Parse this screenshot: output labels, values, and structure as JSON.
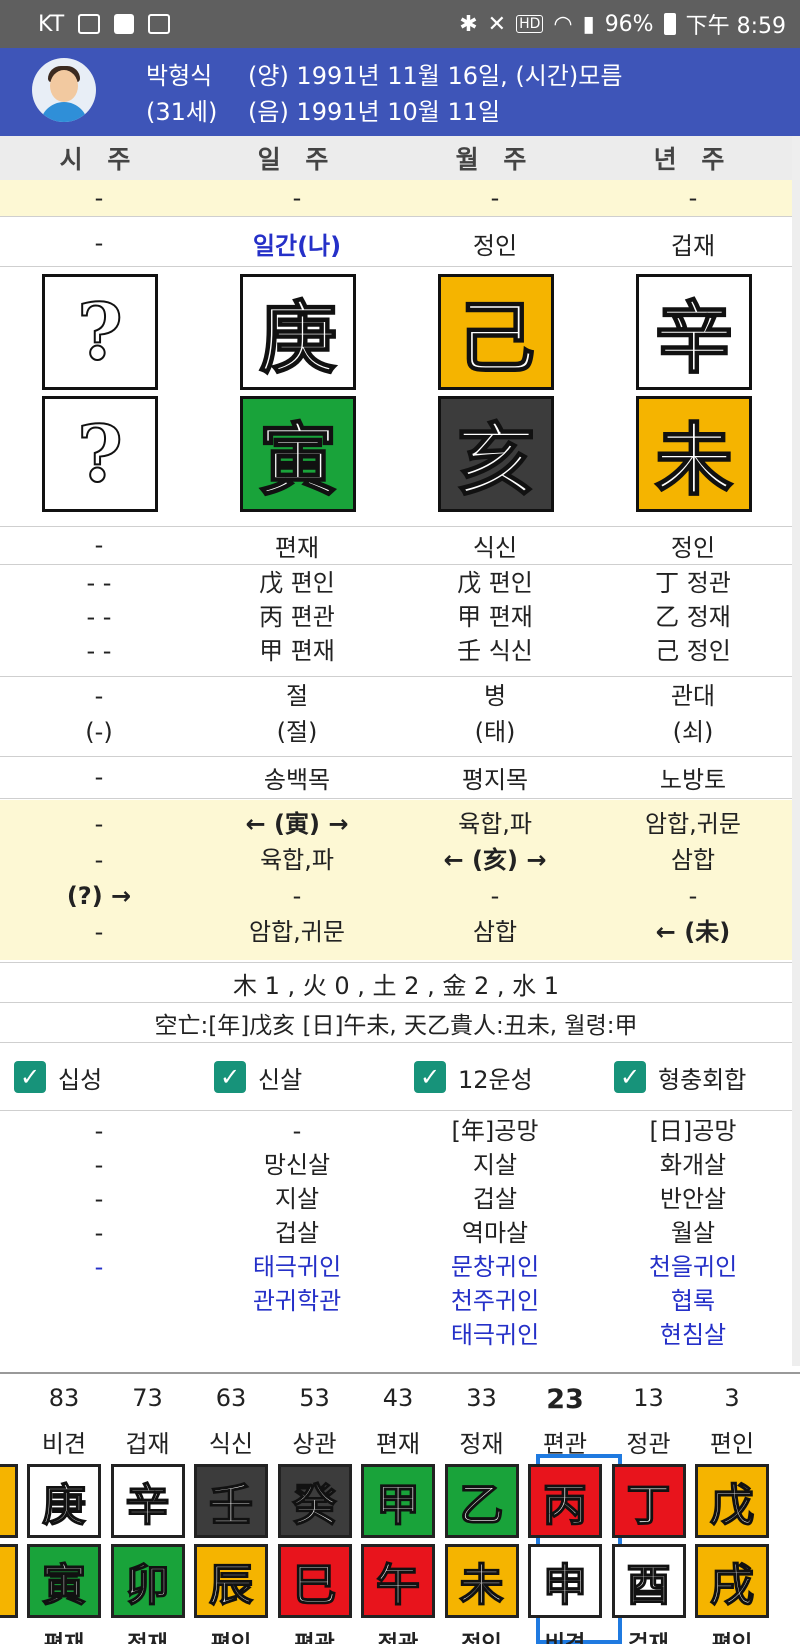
{
  "status_bar": {
    "carrier": "KT",
    "left_icons": [
      "gallery-icon",
      "shopping-bag-icon",
      "sync-icon"
    ],
    "right_icons": [
      "bluetooth-icon",
      "mute-icon",
      "hd-icon",
      "wifi-icon",
      "signal-icon"
    ],
    "battery": "96%",
    "time": "下午 8:59"
  },
  "profile": {
    "name": "박형식",
    "age": "(31세)",
    "solar": "(양) 1991년 11월 16일, (시간)모름",
    "lunar": "(음) 1991년 10월 11일"
  },
  "pillars": {
    "headers": [
      "시 주",
      "일 주",
      "월 주",
      "년 주"
    ],
    "row_top": [
      "-",
      "-",
      "-",
      "-"
    ],
    "stem_tengod": [
      "-",
      "일간(나)",
      "정인",
      "겁재"
    ],
    "stems": [
      {
        "char": "?",
        "color": "white"
      },
      {
        "char": "庚",
        "color": "white"
      },
      {
        "char": "己",
        "color": "orange"
      },
      {
        "char": "辛",
        "color": "white"
      }
    ],
    "branches": [
      {
        "char": "?",
        "color": "white"
      },
      {
        "char": "寅",
        "color": "green"
      },
      {
        "char": "亥",
        "color": "dark"
      },
      {
        "char": "未",
        "color": "orange"
      }
    ],
    "branch_tengod": [
      "-",
      "편재",
      "식신",
      "정인"
    ],
    "hidden_stems": [
      [
        "- -",
        "- -",
        "- -"
      ],
      [
        "戊 편인",
        "丙 편관",
        "甲 편재"
      ],
      [
        "戊 편인",
        "甲 편재",
        "壬 식신"
      ],
      [
        "丁 정관",
        "乙 정재",
        "己 정인"
      ]
    ],
    "twelve_stage": [
      "-",
      "절",
      "병",
      "관대"
    ],
    "twelve_stage_sub": [
      "(-)",
      "(절)",
      "(태)",
      "(쇠)"
    ],
    "napeum": [
      "-",
      "송백목",
      "평지목",
      "노방토"
    ],
    "interactions": [
      [
        "-",
        "← (寅) →",
        "육합,파",
        "암합,귀문"
      ],
      [
        "-",
        "육합,파",
        "← (亥) →",
        "삼합"
      ],
      [
        "(?) →",
        "-",
        "-",
        "-"
      ],
      [
        "-",
        "암합,귀문",
        "삼합",
        "← (未)"
      ]
    ],
    "elements": "木 1 , 火 0 , 土 2 , 金 2 , 水 1",
    "extra": "空亡:[年]戊亥 [日]午未, 天乙貴人:丑未, 월령:甲"
  },
  "checkboxes": [
    {
      "label": "십성",
      "checked": true
    },
    {
      "label": "신살",
      "checked": true
    },
    {
      "label": "12운성",
      "checked": true
    },
    {
      "label": "형충회합",
      "checked": true
    }
  ],
  "shinsal": {
    "black": [
      [
        "-",
        "-",
        "-",
        "-"
      ],
      [
        "-",
        "망신살",
        "지살",
        "겁살"
      ],
      [
        "[年]공망",
        "지살",
        "겁살",
        "역마살"
      ],
      [
        "[日]공망",
        "화개살",
        "반안살",
        "월살"
      ]
    ],
    "blue": [
      [
        "-"
      ],
      [
        "태극귀인",
        "관귀학관"
      ],
      [
        "문창귀인",
        "천주귀인",
        "태극귀인"
      ],
      [
        "천을귀인",
        "협록",
        "현침살"
      ]
    ]
  },
  "daeun": {
    "selected_index": 6,
    "columns": [
      {
        "age": "83",
        "tengod": "비견",
        "stem": "庚",
        "stem_color": "white",
        "branch": "寅",
        "branch_color": "green",
        "bottom": "편재"
      },
      {
        "age": "73",
        "tengod": "겁재",
        "stem": "辛",
        "stem_color": "white",
        "branch": "卯",
        "branch_color": "green",
        "bottom": "정재"
      },
      {
        "age": "63",
        "tengod": "식신",
        "stem": "壬",
        "stem_color": "dark",
        "branch": "辰",
        "branch_color": "orange",
        "bottom": "편인"
      },
      {
        "age": "53",
        "tengod": "상관",
        "stem": "癸",
        "stem_color": "dark",
        "branch": "巳",
        "branch_color": "red",
        "bottom": "편관"
      },
      {
        "age": "43",
        "tengod": "편재",
        "stem": "甲",
        "stem_color": "green",
        "branch": "午",
        "branch_color": "red",
        "bottom": "정관"
      },
      {
        "age": "33",
        "tengod": "정재",
        "stem": "乙",
        "stem_color": "green",
        "branch": "未",
        "branch_color": "orange",
        "bottom": "정인"
      },
      {
        "age": "23",
        "tengod": "편관",
        "stem": "丙",
        "stem_color": "red",
        "branch": "申",
        "branch_color": "white",
        "bottom": "비견"
      },
      {
        "age": "13",
        "tengod": "정관",
        "stem": "丁",
        "stem_color": "red",
        "branch": "酉",
        "branch_color": "white",
        "bottom": "겁재"
      },
      {
        "age": "3",
        "tengod": "편인",
        "stem": "戊",
        "stem_color": "orange",
        "branch": "戌",
        "branch_color": "orange",
        "bottom": "편인"
      }
    ]
  },
  "colors": {
    "header_bg": "#3e55b8",
    "status_bg": "#5f5f5f",
    "highlight_row": "#fdf8d4",
    "check_green": "#17937a",
    "blue_text": "#2530c8",
    "selected_border": "#1f7ae0",
    "wood": "#19a33a",
    "fire": "#e8141c",
    "earth": "#f5b400",
    "water": "#3c3c3c",
    "metal": "#ffffff"
  }
}
